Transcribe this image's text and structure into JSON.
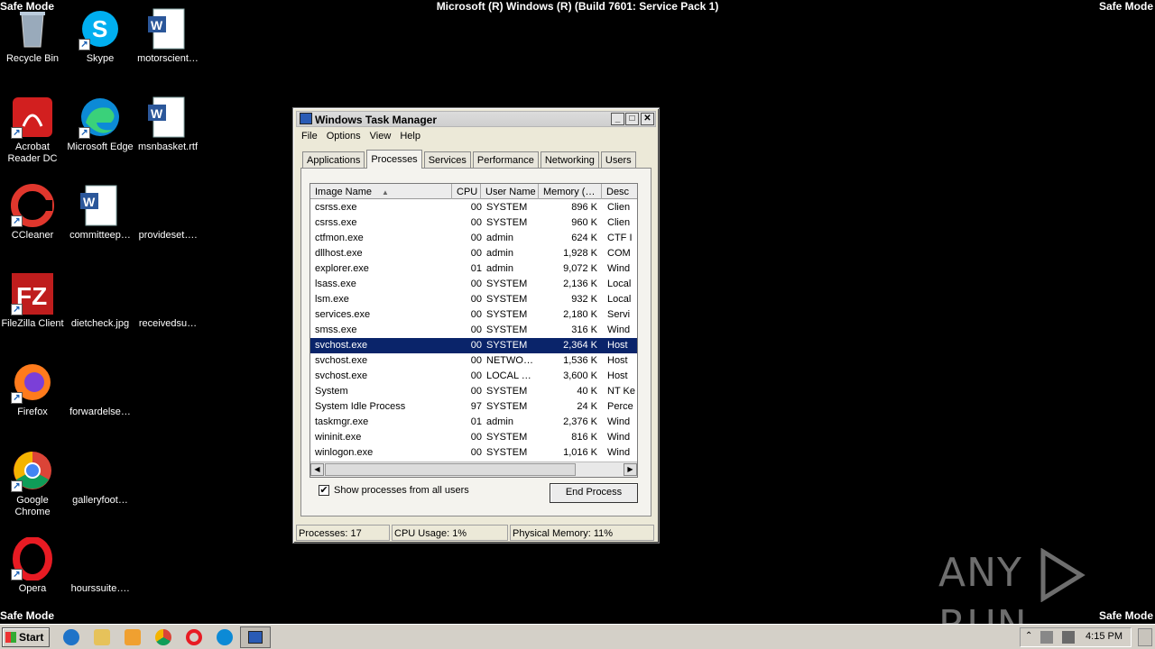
{
  "desktop": {
    "safe_mode": "Safe Mode",
    "build": "Microsoft (R) Windows (R) (Build 7601: Service Pack 1)",
    "icons": [
      {
        "label": "Recycle Bin"
      },
      {
        "label": "Skype"
      },
      {
        "label": "motorscient…"
      },
      {
        "label": "Acrobat Reader DC"
      },
      {
        "label": "Microsoft Edge"
      },
      {
        "label": "msnbasket.rtf"
      },
      {
        "label": "CCleaner"
      },
      {
        "label": "committeep…"
      },
      {
        "label": "provideset…."
      },
      {
        "label": "FileZilla Client"
      },
      {
        "label": "dietcheck.jpg"
      },
      {
        "label": "receivedsu…"
      },
      {
        "label": "Firefox"
      },
      {
        "label": "forwardelse…"
      },
      {
        "label": "Google Chrome"
      },
      {
        "label": "galleryfoot…"
      },
      {
        "label": "Opera"
      },
      {
        "label": "hourssuite…."
      }
    ]
  },
  "taskmgr": {
    "title": "Windows Task Manager",
    "menu": [
      "File",
      "Options",
      "View",
      "Help"
    ],
    "tabs": [
      "Applications",
      "Processes",
      "Services",
      "Performance",
      "Networking",
      "Users"
    ],
    "active_tab": "Processes",
    "columns": [
      "Image Name",
      "CPU",
      "User Name",
      "Memory (…",
      "Desc"
    ],
    "sort_indicator": "▲",
    "rows": [
      {
        "name": "csrss.exe",
        "cpu": "00",
        "user": "SYSTEM",
        "mem": "896 K",
        "desc": "Clien"
      },
      {
        "name": "csrss.exe",
        "cpu": "00",
        "user": "SYSTEM",
        "mem": "960 K",
        "desc": "Clien"
      },
      {
        "name": "ctfmon.exe",
        "cpu": "00",
        "user": "admin",
        "mem": "624 K",
        "desc": "CTF I"
      },
      {
        "name": "dllhost.exe",
        "cpu": "00",
        "user": "admin",
        "mem": "1,928 K",
        "desc": "COM"
      },
      {
        "name": "explorer.exe",
        "cpu": "01",
        "user": "admin",
        "mem": "9,072 K",
        "desc": "Wind"
      },
      {
        "name": "lsass.exe",
        "cpu": "00",
        "user": "SYSTEM",
        "mem": "2,136 K",
        "desc": "Local"
      },
      {
        "name": "lsm.exe",
        "cpu": "00",
        "user": "SYSTEM",
        "mem": "932 K",
        "desc": "Local"
      },
      {
        "name": "services.exe",
        "cpu": "00",
        "user": "SYSTEM",
        "mem": "2,180 K",
        "desc": "Servi"
      },
      {
        "name": "smss.exe",
        "cpu": "00",
        "user": "SYSTEM",
        "mem": "316 K",
        "desc": "Wind"
      },
      {
        "name": "svchost.exe",
        "cpu": "00",
        "user": "SYSTEM",
        "mem": "2,364 K",
        "desc": "Host"
      },
      {
        "name": "svchost.exe",
        "cpu": "00",
        "user": "NETWO…",
        "mem": "1,536 K",
        "desc": "Host"
      },
      {
        "name": "svchost.exe",
        "cpu": "00",
        "user": "LOCAL …",
        "mem": "3,600 K",
        "desc": "Host"
      },
      {
        "name": "System",
        "cpu": "00",
        "user": "SYSTEM",
        "mem": "40 K",
        "desc": "NT Ke"
      },
      {
        "name": "System Idle Process",
        "cpu": "97",
        "user": "SYSTEM",
        "mem": "24 K",
        "desc": "Perce"
      },
      {
        "name": "taskmgr.exe",
        "cpu": "01",
        "user": "admin",
        "mem": "2,376 K",
        "desc": "Wind"
      },
      {
        "name": "wininit.exe",
        "cpu": "00",
        "user": "SYSTEM",
        "mem": "816 K",
        "desc": "Wind"
      },
      {
        "name": "winlogon.exe",
        "cpu": "00",
        "user": "SYSTEM",
        "mem": "1,016 K",
        "desc": "Wind"
      }
    ],
    "selected_row": 9,
    "show_all_label": "Show processes from all users",
    "show_all_checked": "✔",
    "end_process": "End Process",
    "status": {
      "processes": "Processes: 17",
      "cpu": "CPU Usage: 1%",
      "memory": "Physical Memory: 11%"
    }
  },
  "taskbar": {
    "start": "Start",
    "clock": "4:15 PM"
  },
  "watermark": {
    "left": "ANY",
    "right": "RUN"
  }
}
